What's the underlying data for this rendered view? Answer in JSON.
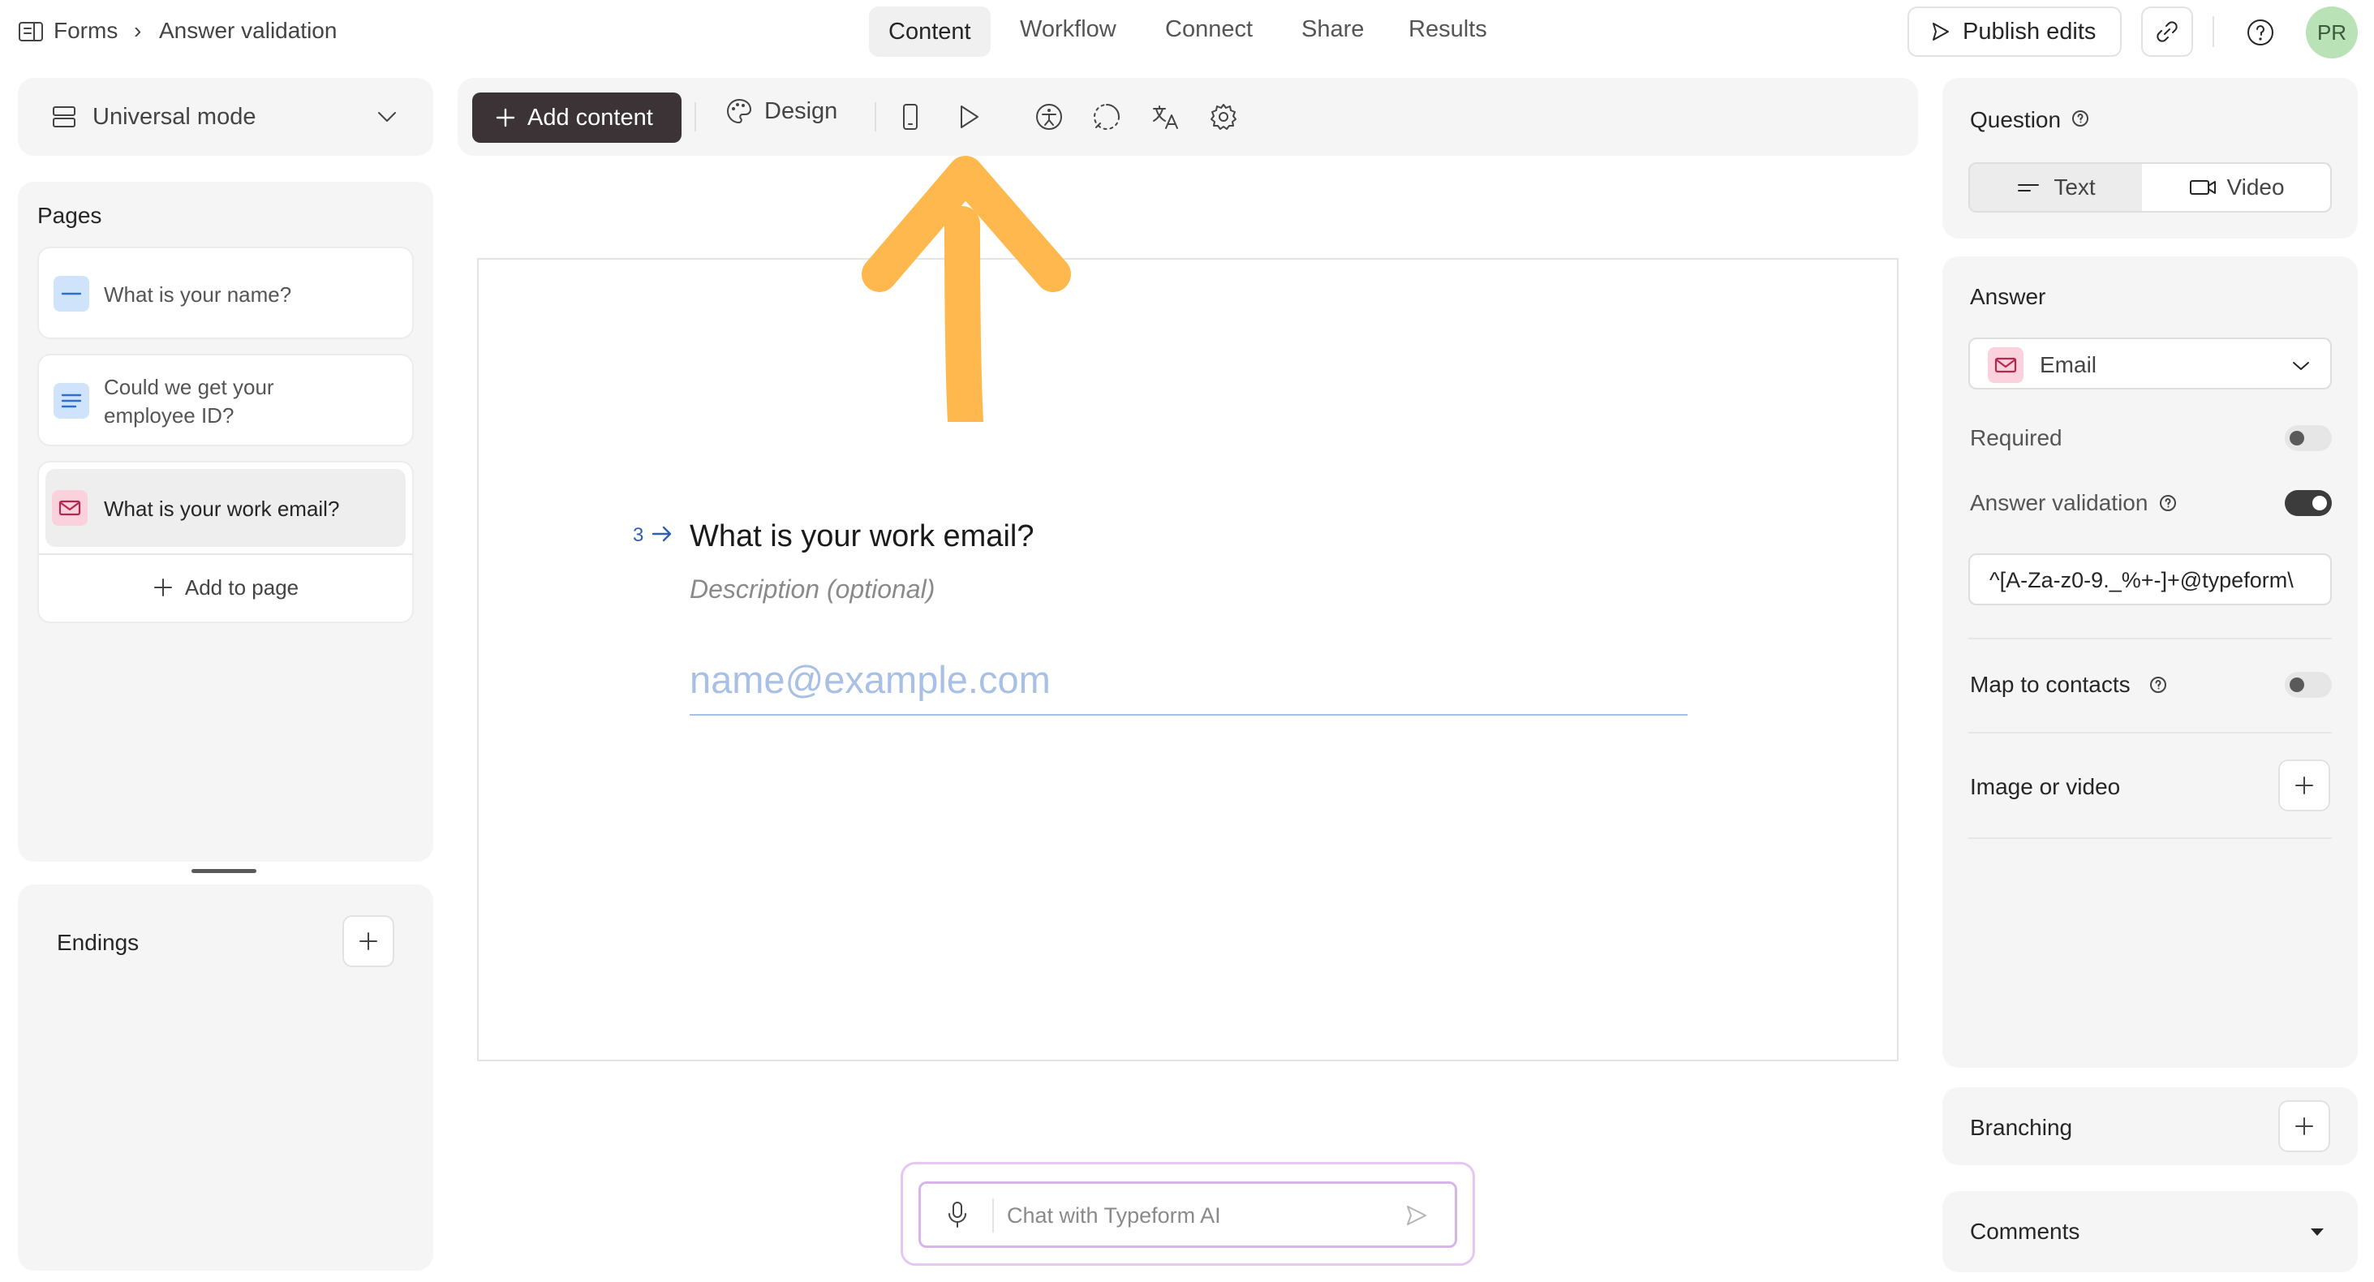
{
  "breadcrumb": {
    "root": "Forms",
    "separator": "›",
    "current": "Answer validation"
  },
  "nav_tabs": [
    {
      "label": "Content",
      "active": true
    },
    {
      "label": "Workflow",
      "active": false
    },
    {
      "label": "Connect",
      "active": false
    },
    {
      "label": "Share",
      "active": false
    },
    {
      "label": "Results",
      "active": false
    }
  ],
  "header_actions": {
    "publish_label": "Publish edits",
    "avatar_initials": "PR"
  },
  "mode_selector": {
    "label": "Universal mode"
  },
  "toolbar": {
    "add_content_label": "Add content",
    "design_label": "Design"
  },
  "pages": {
    "title": "Pages",
    "items": [
      {
        "label": "What is your name?",
        "icon": "short-text-icon"
      },
      {
        "label_line1": "Could we get your",
        "label_line2": "employee ID?",
        "icon": "long-text-icon"
      },
      {
        "label": "What is your work email?",
        "icon": "email-icon",
        "selected": true
      }
    ],
    "add_label": "Add to page"
  },
  "endings": {
    "title": "Endings"
  },
  "canvas": {
    "question_number": "3",
    "question": "What is your work email?",
    "description_placeholder": "Description (optional)",
    "answer_placeholder": "name@example.com"
  },
  "chat": {
    "placeholder": "Chat with Typeform AI"
  },
  "right_panel": {
    "question_title": "Question",
    "question_types": [
      "Text",
      "Video"
    ],
    "answer_title": "Answer",
    "answer_type": "Email",
    "required_label": "Required",
    "required_on": false,
    "validation_label": "Answer validation",
    "validation_on": true,
    "validation_pattern": "^[A-Za-z0-9._%+-]+@typeform\\",
    "map_contacts_label": "Map to contacts",
    "map_contacts_on": false,
    "image_video_label": "Image or video",
    "branching_label": "Branching",
    "comments_label": "Comments"
  },
  "colors": {
    "accent_arrow": "#ffb84d",
    "brand_dark": "#3c3337",
    "chat_border": "#e7c6f2"
  }
}
